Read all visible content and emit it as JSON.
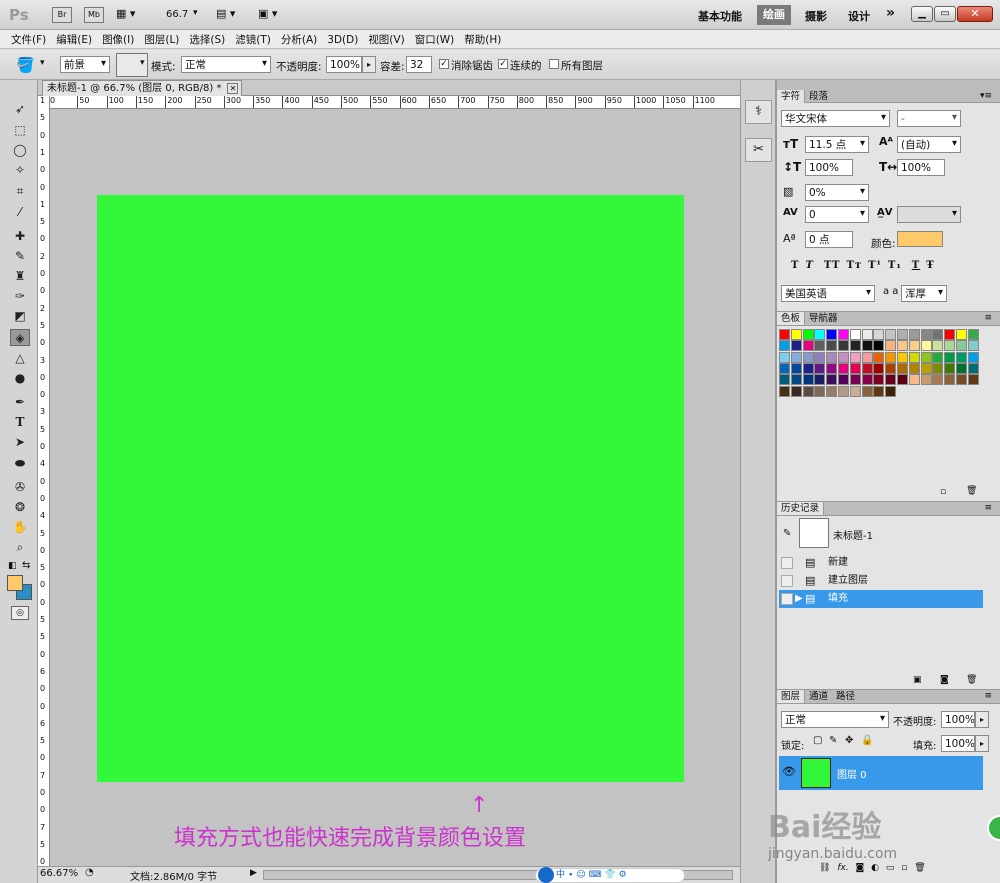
{
  "app": {
    "logo": "Ps",
    "br": "Br",
    "mb": "Mb",
    "zoom": "66.7",
    "workspaces": [
      "基本功能",
      "绘画",
      "摄影",
      "设计"
    ],
    "more": "»"
  },
  "menu": [
    "文件(F)",
    "编辑(E)",
    "图像(I)",
    "图层(L)",
    "选择(S)",
    "滤镜(T)",
    "分析(A)",
    "3D(D)",
    "视图(V)",
    "窗口(W)",
    "帮助(H)"
  ],
  "options": {
    "fill_source": "前景",
    "mode_label": "模式:",
    "mode_value": "正常",
    "opacity_label": "不透明度:",
    "opacity_value": "100%",
    "tolerance_label": "容差:",
    "tolerance_value": "32",
    "antialias": "消除锯齿",
    "contiguous": "连续的",
    "all_layers": "所有图层"
  },
  "document": {
    "tab_title": "未标题-1 @ 66.7% (图层 0, RGB/8) *",
    "fill_color": "#33f83a"
  },
  "ruler_h": [
    "0",
    "50",
    "100",
    "150",
    "200",
    "250",
    "300",
    "350",
    "400",
    "450",
    "500",
    "550",
    "600",
    "650",
    "700",
    "750",
    "800",
    "850",
    "900",
    "950",
    "1000",
    "1050",
    "1100"
  ],
  "ruler_v": [
    "1",
    "5",
    "0",
    "1",
    "0",
    "0",
    "1",
    "5",
    "0",
    "2",
    "0",
    "0",
    "2",
    "5",
    "0",
    "3",
    "0",
    "0",
    "3",
    "5",
    "0",
    "4",
    "0",
    "0",
    "4",
    "5",
    "0",
    "5",
    "0",
    "0",
    "5",
    "5",
    "0",
    "6",
    "0",
    "0",
    "6",
    "5",
    "0",
    "7",
    "0",
    "0",
    "7",
    "5",
    "0"
  ],
  "annotation": "填充方式也能快速完成背景颜色设置",
  "status": {
    "zoom": "66.67%",
    "doc": "文档:2.86M/0 字节"
  },
  "character": {
    "tabs": [
      "字符",
      "段落"
    ],
    "font": "华文宋体",
    "style": "-",
    "size": "11.5 点",
    "leading": "(自动)",
    "vscale": "100%",
    "hscale": "100%",
    "tracking_pct": "0%",
    "kerning": "0",
    "baseline": "0 点",
    "color_label": "颜色:",
    "color": "#ffc96b",
    "lang": "美国英语",
    "aa_label": "a a",
    "aa": "浑厚",
    "styles": [
      "T",
      "T",
      "TT",
      "Tт",
      "T¹",
      "T₁",
      "T",
      "Ŧ"
    ]
  },
  "swatches": {
    "tabs": [
      "色板",
      "导航器"
    ]
  },
  "history": {
    "tab": "历史记录",
    "snapshot": "未标题-1",
    "items": [
      "新建",
      "建立图层",
      "填充"
    ]
  },
  "layers": {
    "tabs": [
      "图层",
      "通道",
      "路径"
    ],
    "blend": "正常",
    "opacity_label": "不透明度:",
    "opacity": "100%",
    "lock_label": "锁定:",
    "fill_label": "填充:",
    "fill": "100%",
    "layer_name": "图层 0",
    "layer_color": "#33f83a"
  },
  "watermark": {
    "text": "Bai经验",
    "url": "jingyan.baidu.com"
  }
}
